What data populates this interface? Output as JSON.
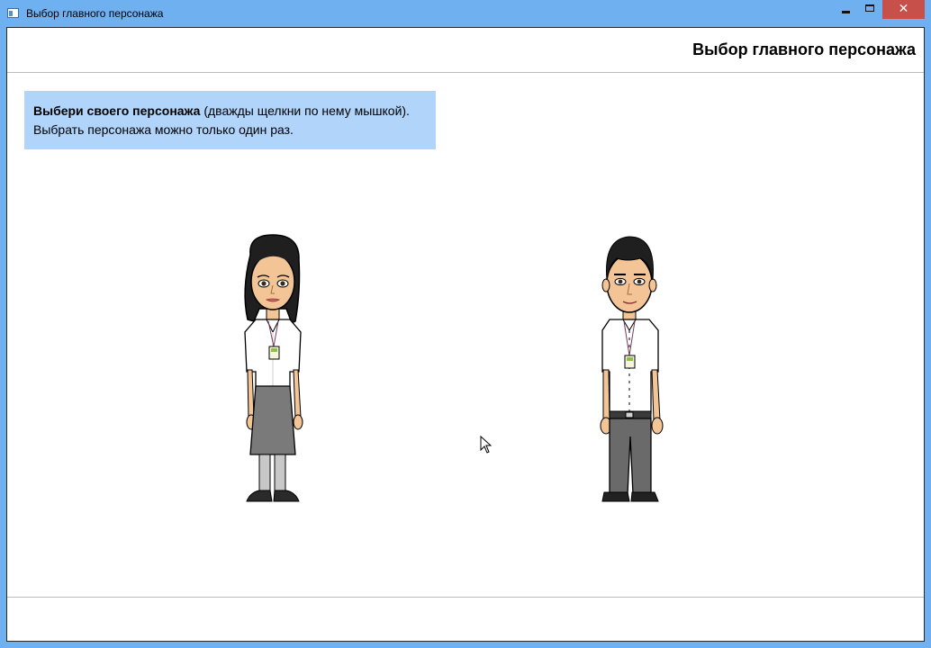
{
  "window": {
    "title": "Выбор главного персонажа",
    "close_symbol": "✕"
  },
  "header": {
    "title": "Выбор главного персонажа"
  },
  "instructions": {
    "bold_text": "Выбери своего персонажа",
    "text_after_bold": " (дважды щелкни по нему мышкой).",
    "line2": "Выбрать персонажа можно только один раз."
  },
  "characters": [
    {
      "id": "female",
      "icon": "female-character-icon"
    },
    {
      "id": "male",
      "icon": "male-character-icon"
    }
  ],
  "colors": {
    "titlebar": "#6fb0f0",
    "close_button": "#c7504a",
    "instruction_bg": "#b0d4fa"
  }
}
